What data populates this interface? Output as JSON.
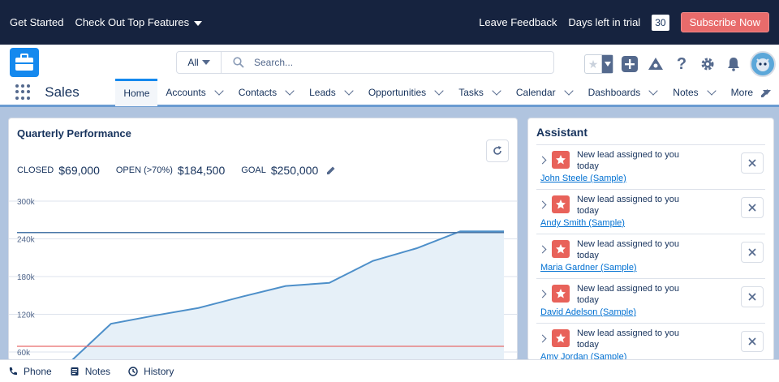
{
  "trialbar": {
    "get_started": "Get Started",
    "top_features": "Check Out Top Features",
    "leave_feedback": "Leave Feedback",
    "days_left_label": "Days left in trial",
    "days_left": "30",
    "subscribe": "Subscribe Now"
  },
  "header": {
    "search_scope": "All",
    "search_placeholder": "Search..."
  },
  "nav": {
    "app_name": "Sales",
    "tabs": [
      {
        "label": "Home"
      },
      {
        "label": "Accounts"
      },
      {
        "label": "Contacts"
      },
      {
        "label": "Leads"
      },
      {
        "label": "Opportunities"
      },
      {
        "label": "Tasks"
      },
      {
        "label": "Calendar"
      },
      {
        "label": "Dashboards"
      },
      {
        "label": "Notes"
      },
      {
        "label": "More"
      }
    ]
  },
  "performance": {
    "title": "Quarterly Performance",
    "closed_label": "CLOSED",
    "closed_value": "$69,000",
    "open_label": "OPEN (>70%)",
    "open_value": "$184,500",
    "goal_label": "GOAL",
    "goal_value": "$250,000"
  },
  "chart_data": {
    "type": "area",
    "title": "",
    "xlabel": "",
    "ylabel": "",
    "ylim": [
      0,
      300000
    ],
    "yticks": [
      "300k",
      "240k",
      "180k",
      "120k",
      "60k"
    ],
    "ytick_values": [
      300000,
      240000,
      180000,
      120000,
      60000
    ],
    "goal_line": 250000,
    "closed_line": 69000,
    "x": [
      0,
      1,
      2,
      3,
      4,
      5,
      6,
      7,
      8,
      9,
      10
    ],
    "values": [
      40000,
      105000,
      118000,
      130000,
      148000,
      165000,
      170000,
      205000,
      225000,
      252000,
      252000
    ],
    "grid": true,
    "colors": {
      "line": "#4d8fc9",
      "fill": "#e6f0f8",
      "goal": "#4a77a8",
      "closed": "#e86b6b"
    }
  },
  "assistant": {
    "title": "Assistant",
    "items": [
      {
        "text": "New lead assigned to you today",
        "link": "John Steele (Sample)"
      },
      {
        "text": "New lead assigned to you today",
        "link": "Andy Smith (Sample)"
      },
      {
        "text": "New lead assigned to you today",
        "link": "Maria Gardner (Sample)"
      },
      {
        "text": "New lead assigned to you today",
        "link": "David Adelson (Sample)"
      },
      {
        "text": "New lead assigned to you today",
        "link": "Amy Jordan (Sample)"
      }
    ]
  },
  "utility": {
    "phone": "Phone",
    "notes": "Notes",
    "history": "History"
  }
}
